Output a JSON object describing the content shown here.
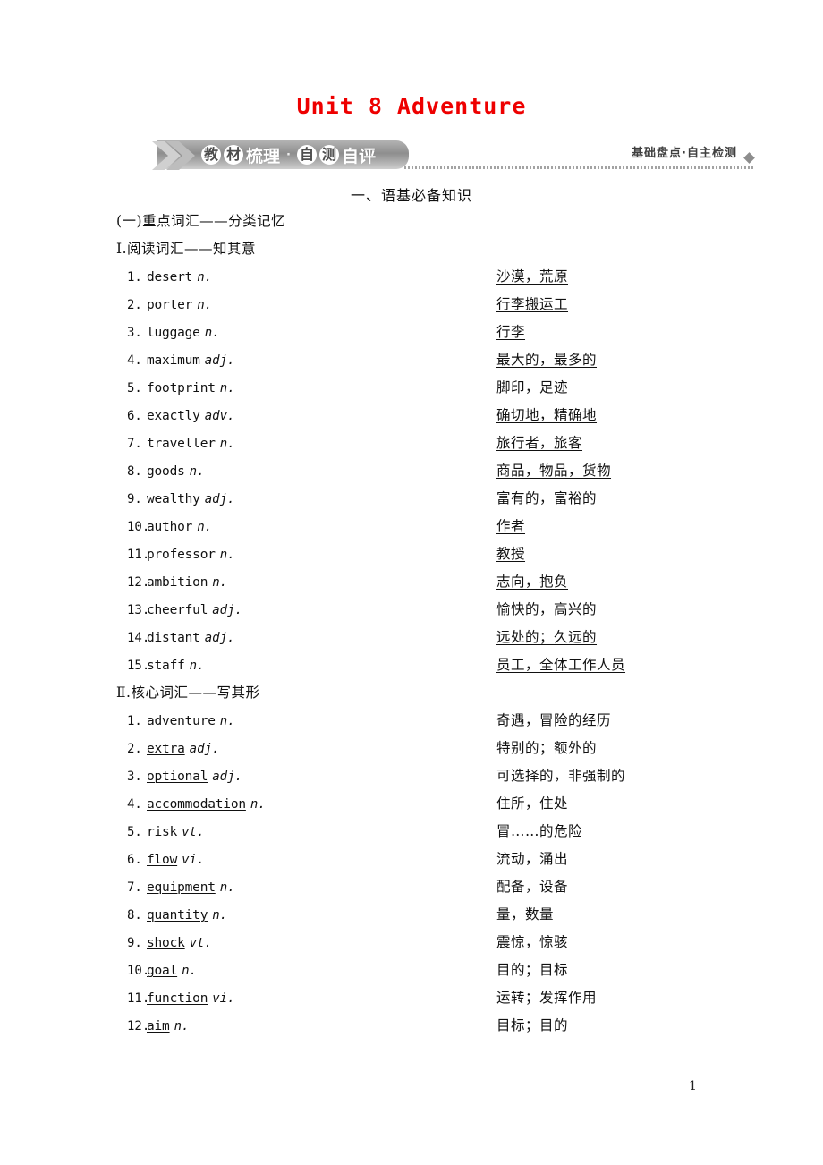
{
  "page": {
    "unit_title": "Unit 8 Adventure",
    "page_number": "1"
  },
  "banner": {
    "chevron_icon": "double-chevron-right-icon",
    "parts": [
      {
        "text": "教",
        "circled": true
      },
      {
        "text": "材",
        "circled": true
      },
      {
        "text": "梳理",
        "circled": false
      },
      {
        "text": "·",
        "circled": false
      },
      {
        "text": "自",
        "circled": true
      },
      {
        "text": "测",
        "circled": true
      },
      {
        "text": "自评",
        "circled": false
      }
    ],
    "side_label": "基础盘点·自主检测",
    "diamond_icon": "diamond-bullet-icon",
    "gradient_from": "#b3b3b3",
    "gradient_to": "#cfcfcf"
  },
  "headings": {
    "main": "一、语基必备知识",
    "group_a": "(一)重点词汇——分类记忆",
    "section_1": "Ⅰ.阅读词汇——知其意",
    "section_2": "Ⅱ.核心词汇——写其形"
  },
  "reading_vocab": [
    {
      "num": "1.",
      "word": "desert",
      "pos": "n.",
      "meaning": "沙漠，荒原"
    },
    {
      "num": "2.",
      "word": "porter",
      "pos": "n.",
      "meaning": "行李搬运工"
    },
    {
      "num": "3.",
      "word": "luggage",
      "pos": "n.",
      "meaning": "行李"
    },
    {
      "num": "4.",
      "word": "maximum",
      "pos": "adj.",
      "meaning": "最大的，最多的"
    },
    {
      "num": "5.",
      "word": "footprint",
      "pos": "n.",
      "meaning": "脚印，足迹"
    },
    {
      "num": "6.",
      "word": "exactly",
      "pos": "adv.",
      "meaning": "确切地，精确地"
    },
    {
      "num": "7.",
      "word": "traveller",
      "pos": "n.",
      "meaning": "旅行者，旅客"
    },
    {
      "num": "8.",
      "word": "goods",
      "pos": "n.",
      "meaning": "商品，物品，货物"
    },
    {
      "num": "9.",
      "word": "wealthy",
      "pos": "adj.",
      "meaning": "富有的，富裕的"
    },
    {
      "num": "10.",
      "word": "author",
      "pos": "n.",
      "meaning": "作者"
    },
    {
      "num": "11.",
      "word": "professor",
      "pos": "n.",
      "meaning": "教授"
    },
    {
      "num": "12.",
      "word": "ambition",
      "pos": "n.",
      "meaning": "志向，抱负"
    },
    {
      "num": "13.",
      "word": "cheerful",
      "pos": "adj.",
      "meaning": "愉快的，高兴的"
    },
    {
      "num": "14.",
      "word": "distant",
      "pos": "adj.",
      "meaning": "远处的；久远的"
    },
    {
      "num": "15.",
      "word": "staff",
      "pos": "n.",
      "meaning": "员工，全体工作人员"
    }
  ],
  "core_vocab": [
    {
      "num": "1.",
      "word": "adventure",
      "pos": "n.",
      "meaning": "奇遇，冒险的经历"
    },
    {
      "num": "2.",
      "word": "extra",
      "pos": "adj.",
      "meaning": "特别的；额外的"
    },
    {
      "num": "3.",
      "word": "optional",
      "pos": "adj.",
      "meaning": "可选择的，非强制的"
    },
    {
      "num": "4.",
      "word": "accommodation",
      "pos": "n.",
      "meaning": "住所，住处"
    },
    {
      "num": "5.",
      "word": "risk",
      "pos": "vt.",
      "meaning": "冒……的危险"
    },
    {
      "num": "6.",
      "word": "flow",
      "pos": "vi.",
      "meaning": "流动，涌出"
    },
    {
      "num": "7.",
      "word": "equipment",
      "pos": "n.",
      "meaning": "配备，设备"
    },
    {
      "num": "8.",
      "word": "quantity",
      "pos": "n.",
      "meaning": "量，数量"
    },
    {
      "num": "9.",
      "word": "shock",
      "pos": "vt.",
      "meaning": "震惊，惊骇"
    },
    {
      "num": "10.",
      "word": "goal",
      "pos": "n.",
      "meaning": "目的；目标"
    },
    {
      "num": "11.",
      "word": "function",
      "pos": "vi.",
      "meaning": "运转；发挥作用"
    },
    {
      "num": "12.",
      "word": "aim",
      "pos": "n.",
      "meaning": "目标；目的"
    }
  ]
}
